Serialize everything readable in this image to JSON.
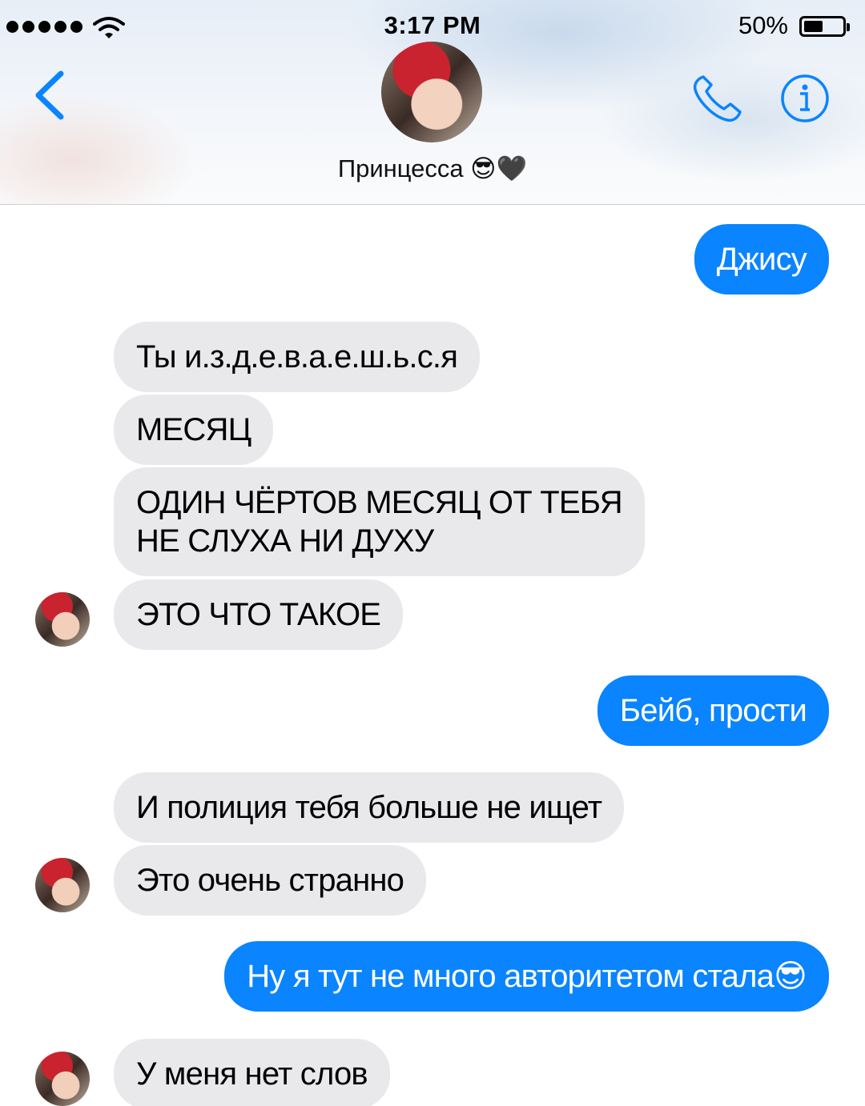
{
  "status_bar": {
    "time": "3:17 PM",
    "battery_percent": "50%",
    "battery_level": 0.5,
    "signal_dots": 5,
    "icons": [
      "signal-icon",
      "wifi-icon",
      "battery-icon"
    ]
  },
  "header": {
    "contact_name": "Принцесса 😎🖤",
    "back_icon": "chevron-left-icon",
    "call_icon": "phone-icon",
    "info_icon": "info-icon",
    "accent_color": "#0a84ff"
  },
  "messages": [
    {
      "direction": "out",
      "text": "Джису"
    },
    {
      "direction": "in",
      "text": "Ты и.з.д.е.в.а.е.ш.ь.с.я"
    },
    {
      "direction": "in",
      "text": "МЕСЯЦ"
    },
    {
      "direction": "in",
      "lines": [
        "ОДИН ЧЁРТОВ МЕСЯЦ ОТ ТЕБЯ",
        "НЕ СЛУХА НИ ДУХУ"
      ]
    },
    {
      "direction": "in",
      "text": "ЭТО ЧТО ТАКОЕ"
    },
    {
      "direction": "out",
      "text": "Бейб, прости"
    },
    {
      "direction": "in",
      "text": "И полиция тебя больше не ищет"
    },
    {
      "direction": "in",
      "text": "Это очень странно"
    },
    {
      "direction": "out",
      "text": "Ну я тут не много авторитетом стала😎"
    },
    {
      "direction": "in",
      "text": "У меня нет слов"
    }
  ],
  "colors": {
    "incoming_bubble": "#e9e9eb",
    "outgoing_bubble": "#0a84ff"
  }
}
